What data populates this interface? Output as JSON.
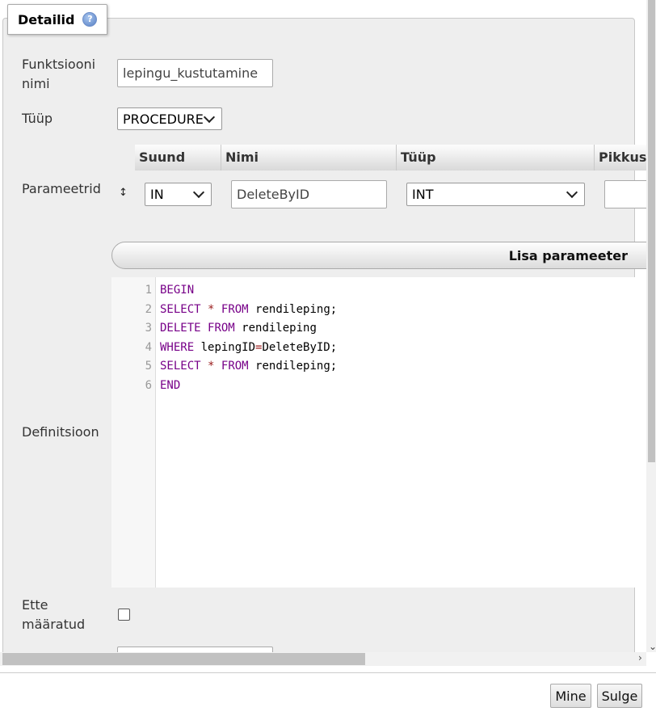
{
  "legend": {
    "title": "Detailid",
    "help_icon": "help-icon"
  },
  "form": {
    "function_name_label": "Funktsiooni nimi",
    "function_name_value": "lepingu_kustutamine",
    "type_label": "Tüüp",
    "type_value": "PROCEDURE",
    "params_label": "Parameetrid",
    "definition_label": "Definitsioon",
    "deterministic_label": "Ette määratud"
  },
  "params_table": {
    "columns": [
      "Suund",
      "Nimi",
      "Tüüp",
      "Pikkus"
    ],
    "row": {
      "direction": "IN",
      "name": "DeleteByID",
      "type": "INT",
      "length": ""
    },
    "add_button": "Lisa parameeter"
  },
  "editor": {
    "lines": [
      {
        "num": "1",
        "tokens": [
          [
            "kw",
            "BEGIN"
          ]
        ]
      },
      {
        "num": "2",
        "tokens": [
          [
            "kw",
            "SELECT"
          ],
          [
            "t",
            " "
          ],
          [
            "op",
            "*"
          ],
          [
            "t",
            " "
          ],
          [
            "kw",
            "FROM"
          ],
          [
            "t",
            " rendileping;"
          ]
        ]
      },
      {
        "num": "3",
        "tokens": [
          [
            "kw",
            "DELETE"
          ],
          [
            "t",
            " "
          ],
          [
            "kw",
            "FROM"
          ],
          [
            "t",
            " rendileping"
          ]
        ]
      },
      {
        "num": "4",
        "tokens": [
          [
            "kw",
            "WHERE"
          ],
          [
            "t",
            " lepingID"
          ],
          [
            "op",
            "="
          ],
          [
            "t",
            "DeleteByID;"
          ]
        ]
      },
      {
        "num": "5",
        "tokens": [
          [
            "kw",
            "SELECT"
          ],
          [
            "t",
            " "
          ],
          [
            "op",
            "*"
          ],
          [
            "t",
            " "
          ],
          [
            "kw",
            "FROM"
          ],
          [
            "t",
            " rendileping;"
          ]
        ]
      },
      {
        "num": "6",
        "tokens": [
          [
            "kw",
            "END"
          ]
        ]
      }
    ]
  },
  "footer": {
    "go_button": "Mine",
    "close_button": "Sulge"
  }
}
